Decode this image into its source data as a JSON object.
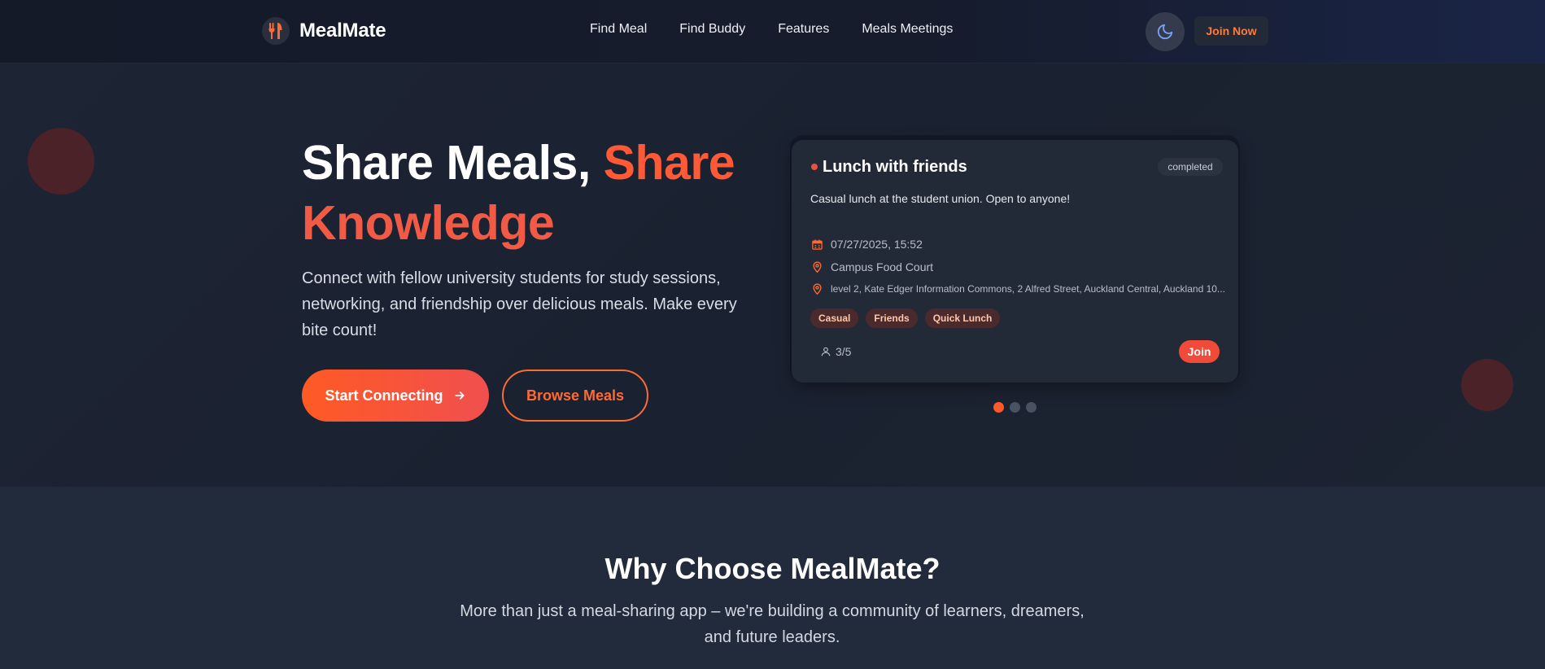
{
  "nav": {
    "brand": "MealMate",
    "links": [
      "Find Meal",
      "Find Buddy",
      "Features",
      "Meals Meetings"
    ],
    "join_label": "Join Now",
    "theme_icon": "moon-icon",
    "logo_icon": "utensils-icon"
  },
  "hero": {
    "title_part1": "Share Meals, ",
    "title_part2": "Share",
    "title_part3": "Knowledge",
    "subtitle": "Connect with fellow university students for study sessions, networking, and friendship over delicious meals. Make every bite count!",
    "start_label": "Start Connecting",
    "browse_label": "Browse Meals"
  },
  "meal_card": {
    "title": "Lunch with friends",
    "status": "completed",
    "description": "Casual lunch at the student union. Open to anyone!",
    "datetime": "07/27/2025, 15:52",
    "venue": "Campus Food Court",
    "address": "level 2, Kate Edger Information Commons, 2 Alfred Street, Auckland Central, Auckland 10...",
    "tags": [
      "Casual",
      "Friends",
      "Quick Lunch"
    ],
    "participants": "3/5",
    "join_label": "Join"
  },
  "carousel": {
    "count": 3,
    "active": 0
  },
  "why": {
    "title": "Why Choose MealMate?",
    "subtitle": "More than just a meal-sharing app – we're building a community of learners, dreamers, and future leaders."
  },
  "colors": {
    "accent": "#ff5a25",
    "accent_red": "#f04a38",
    "bg_dark": "#1b2231",
    "card_bg": "#232a37"
  }
}
